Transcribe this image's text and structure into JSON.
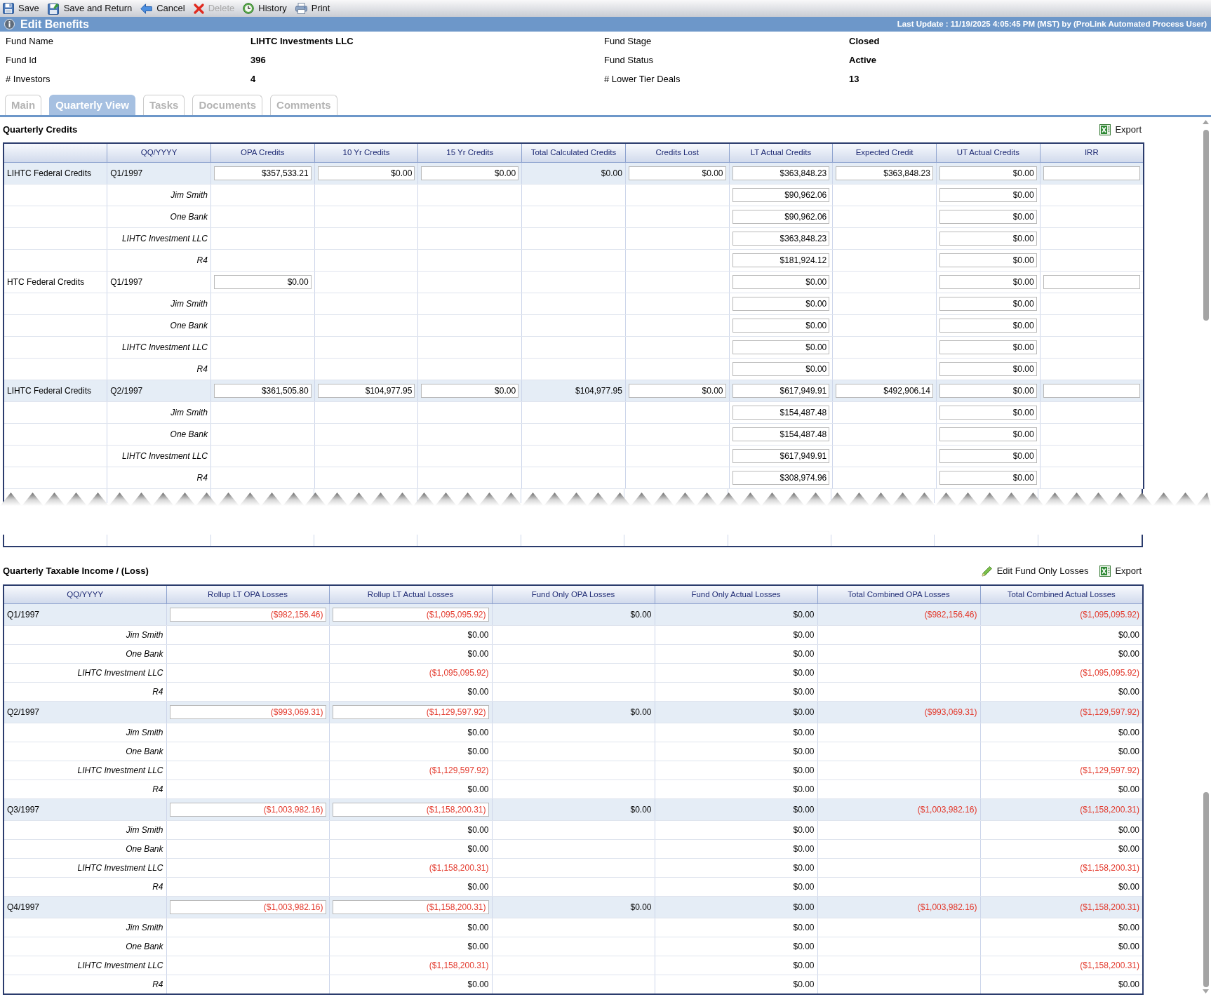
{
  "toolbar": [
    {
      "kind": "save",
      "label": "Save",
      "disabled": false
    },
    {
      "kind": "save_return",
      "label": "Save and Return",
      "disabled": false
    },
    {
      "kind": "cancel",
      "label": "Cancel",
      "disabled": false
    },
    {
      "kind": "delete",
      "label": "Delete",
      "disabled": true
    },
    {
      "kind": "history",
      "label": "History",
      "disabled": false
    },
    {
      "kind": "print",
      "label": "Print",
      "disabled": false
    }
  ],
  "header": {
    "title": "Edit Benefits",
    "last_update": "Last Update : 11/19/2025 4:05:45 PM (MST) by (ProLink Automated Process User)"
  },
  "fund_info": [
    {
      "label": "Fund Name",
      "value": "LIHTC Investments LLC"
    },
    {
      "label": "Fund Stage",
      "value": "Closed"
    },
    {
      "label": "Fund Id",
      "value": "396"
    },
    {
      "label": "Fund Status",
      "value": "Active"
    },
    {
      "label": "# Investors",
      "value": "4"
    },
    {
      "label": "# Lower Tier Deals",
      "value": "13"
    }
  ],
  "tabs": [
    {
      "label": "Main",
      "selected": false
    },
    {
      "label": "Quarterly View",
      "selected": true
    },
    {
      "label": "Tasks",
      "selected": false
    },
    {
      "label": "Documents",
      "selected": false
    },
    {
      "label": "Comments",
      "selected": false
    }
  ],
  "quarterly_credits": {
    "title": "Quarterly Credits",
    "actions": [
      {
        "kind": "export",
        "label": "Export"
      }
    ],
    "columns": [
      "",
      "QQ/YYYY",
      "OPA Credits",
      "10 Yr Credits",
      "15 Yr Credits",
      "Total Calculated Credits",
      "Credits Lost",
      "LT Actual Credits",
      "Expected Credit",
      "UT Actual Credits",
      "IRR"
    ],
    "rows": [
      {
        "shaded": true,
        "cells": [
          {
            "kind": "label",
            "value": "LIHTC Federal Credits"
          },
          {
            "kind": "label",
            "value": "Q1/1997"
          },
          {
            "kind": "input",
            "value": "$357,533.21"
          },
          {
            "kind": "input",
            "value": "$0.00"
          },
          {
            "kind": "input",
            "value": "$0.00"
          },
          {
            "kind": "text",
            "value": "$0.00"
          },
          {
            "kind": "input",
            "value": "$0.00"
          },
          {
            "kind": "input",
            "value": "$363,848.23"
          },
          {
            "kind": "input",
            "value": "$363,848.23"
          },
          {
            "kind": "input",
            "value": "$0.00"
          },
          {
            "kind": "input"
          }
        ]
      },
      {
        "shaded": false,
        "cells": [
          {
            "kind": "blank"
          },
          {
            "kind": "name",
            "value": "Jim Smith"
          },
          {
            "kind": "blank"
          },
          {
            "kind": "blank"
          },
          {
            "kind": "blank"
          },
          {
            "kind": "blank"
          },
          {
            "kind": "blank"
          },
          {
            "kind": "input",
            "value": "$90,962.06"
          },
          {
            "kind": "blank"
          },
          {
            "kind": "input",
            "value": "$0.00"
          },
          {
            "kind": "blank"
          }
        ]
      },
      {
        "shaded": false,
        "cells": [
          {
            "kind": "blank"
          },
          {
            "kind": "name",
            "value": "One Bank"
          },
          {
            "kind": "blank"
          },
          {
            "kind": "blank"
          },
          {
            "kind": "blank"
          },
          {
            "kind": "blank"
          },
          {
            "kind": "blank"
          },
          {
            "kind": "input",
            "value": "$90,962.06"
          },
          {
            "kind": "blank"
          },
          {
            "kind": "input",
            "value": "$0.00"
          },
          {
            "kind": "blank"
          }
        ]
      },
      {
        "shaded": false,
        "cells": [
          {
            "kind": "blank"
          },
          {
            "kind": "name",
            "value": "LIHTC Investment LLC"
          },
          {
            "kind": "blank"
          },
          {
            "kind": "blank"
          },
          {
            "kind": "blank"
          },
          {
            "kind": "blank"
          },
          {
            "kind": "blank"
          },
          {
            "kind": "input",
            "value": "$363,848.23"
          },
          {
            "kind": "blank"
          },
          {
            "kind": "input",
            "value": "$0.00"
          },
          {
            "kind": "blank"
          }
        ]
      },
      {
        "shaded": false,
        "cells": [
          {
            "kind": "blank"
          },
          {
            "kind": "name",
            "value": "R4"
          },
          {
            "kind": "blank"
          },
          {
            "kind": "blank"
          },
          {
            "kind": "blank"
          },
          {
            "kind": "blank"
          },
          {
            "kind": "blank"
          },
          {
            "kind": "input",
            "value": "$181,924.12"
          },
          {
            "kind": "blank"
          },
          {
            "kind": "input",
            "value": "$0.00"
          },
          {
            "kind": "blank"
          }
        ]
      },
      {
        "shaded": false,
        "cells": [
          {
            "kind": "label",
            "value": "HTC Federal Credits"
          },
          {
            "kind": "label",
            "value": "Q1/1997"
          },
          {
            "kind": "input",
            "value": "$0.00"
          },
          {
            "kind": "blank"
          },
          {
            "kind": "blank"
          },
          {
            "kind": "blank"
          },
          {
            "kind": "blank"
          },
          {
            "kind": "input",
            "value": "$0.00"
          },
          {
            "kind": "blank"
          },
          {
            "kind": "input",
            "value": "$0.00"
          },
          {
            "kind": "input"
          }
        ]
      },
      {
        "shaded": false,
        "cells": [
          {
            "kind": "blank"
          },
          {
            "kind": "name",
            "value": "Jim Smith"
          },
          {
            "kind": "blank"
          },
          {
            "kind": "blank"
          },
          {
            "kind": "blank"
          },
          {
            "kind": "blank"
          },
          {
            "kind": "blank"
          },
          {
            "kind": "input",
            "value": "$0.00"
          },
          {
            "kind": "blank"
          },
          {
            "kind": "input",
            "value": "$0.00"
          },
          {
            "kind": "blank"
          }
        ]
      },
      {
        "shaded": false,
        "cells": [
          {
            "kind": "blank"
          },
          {
            "kind": "name",
            "value": "One Bank"
          },
          {
            "kind": "blank"
          },
          {
            "kind": "blank"
          },
          {
            "kind": "blank"
          },
          {
            "kind": "blank"
          },
          {
            "kind": "blank"
          },
          {
            "kind": "input",
            "value": "$0.00"
          },
          {
            "kind": "blank"
          },
          {
            "kind": "input",
            "value": "$0.00"
          },
          {
            "kind": "blank"
          }
        ]
      },
      {
        "shaded": false,
        "cells": [
          {
            "kind": "blank"
          },
          {
            "kind": "name",
            "value": "LIHTC Investment LLC"
          },
          {
            "kind": "blank"
          },
          {
            "kind": "blank"
          },
          {
            "kind": "blank"
          },
          {
            "kind": "blank"
          },
          {
            "kind": "blank"
          },
          {
            "kind": "input",
            "value": "$0.00"
          },
          {
            "kind": "blank"
          },
          {
            "kind": "input",
            "value": "$0.00"
          },
          {
            "kind": "blank"
          }
        ]
      },
      {
        "shaded": false,
        "cells": [
          {
            "kind": "blank"
          },
          {
            "kind": "name",
            "value": "R4"
          },
          {
            "kind": "blank"
          },
          {
            "kind": "blank"
          },
          {
            "kind": "blank"
          },
          {
            "kind": "blank"
          },
          {
            "kind": "blank"
          },
          {
            "kind": "input",
            "value": "$0.00"
          },
          {
            "kind": "blank"
          },
          {
            "kind": "input",
            "value": "$0.00"
          },
          {
            "kind": "blank"
          }
        ]
      },
      {
        "shaded": true,
        "cells": [
          {
            "kind": "label",
            "value": "LIHTC Federal Credits"
          },
          {
            "kind": "label",
            "value": "Q2/1997"
          },
          {
            "kind": "input",
            "value": "$361,505.80"
          },
          {
            "kind": "input",
            "value": "$104,977.95"
          },
          {
            "kind": "input",
            "value": "$0.00"
          },
          {
            "kind": "text",
            "value": "$104,977.95"
          },
          {
            "kind": "input",
            "value": "$0.00"
          },
          {
            "kind": "input",
            "value": "$617,949.91"
          },
          {
            "kind": "input",
            "value": "$492,906.14"
          },
          {
            "kind": "input",
            "value": "$0.00"
          },
          {
            "kind": "input"
          }
        ]
      },
      {
        "shaded": false,
        "cells": [
          {
            "kind": "blank"
          },
          {
            "kind": "name",
            "value": "Jim Smith"
          },
          {
            "kind": "blank"
          },
          {
            "kind": "blank"
          },
          {
            "kind": "blank"
          },
          {
            "kind": "blank"
          },
          {
            "kind": "blank"
          },
          {
            "kind": "input",
            "value": "$154,487.48"
          },
          {
            "kind": "blank"
          },
          {
            "kind": "input",
            "value": "$0.00"
          },
          {
            "kind": "blank"
          }
        ]
      },
      {
        "shaded": false,
        "cells": [
          {
            "kind": "blank"
          },
          {
            "kind": "name",
            "value": "One Bank"
          },
          {
            "kind": "blank"
          },
          {
            "kind": "blank"
          },
          {
            "kind": "blank"
          },
          {
            "kind": "blank"
          },
          {
            "kind": "blank"
          },
          {
            "kind": "input",
            "value": "$154,487.48"
          },
          {
            "kind": "blank"
          },
          {
            "kind": "input",
            "value": "$0.00"
          },
          {
            "kind": "blank"
          }
        ]
      },
      {
        "shaded": false,
        "cells": [
          {
            "kind": "blank"
          },
          {
            "kind": "name",
            "value": "LIHTC Investment LLC"
          },
          {
            "kind": "blank"
          },
          {
            "kind": "blank"
          },
          {
            "kind": "blank"
          },
          {
            "kind": "blank"
          },
          {
            "kind": "blank"
          },
          {
            "kind": "input",
            "value": "$617,949.91"
          },
          {
            "kind": "blank"
          },
          {
            "kind": "input",
            "value": "$0.00"
          },
          {
            "kind": "blank"
          }
        ]
      },
      {
        "shaded": false,
        "cells": [
          {
            "kind": "blank"
          },
          {
            "kind": "name",
            "value": "R4"
          },
          {
            "kind": "blank"
          },
          {
            "kind": "blank"
          },
          {
            "kind": "blank"
          },
          {
            "kind": "blank"
          },
          {
            "kind": "blank"
          },
          {
            "kind": "input",
            "value": "$308,974.96"
          },
          {
            "kind": "blank"
          },
          {
            "kind": "input",
            "value": "$0.00"
          },
          {
            "kind": "blank"
          }
        ]
      }
    ]
  },
  "quarterly_taxable_income": {
    "title": "Quarterly Taxable Income / (Loss)",
    "actions": [
      {
        "kind": "edit",
        "label": "Edit Fund Only Losses"
      },
      {
        "kind": "export",
        "label": "Export"
      }
    ],
    "columns": [
      "QQ/YYYY",
      "Rollup LT OPA Losses",
      "Rollup LT Actual Losses",
      "Fund Only OPA Losses",
      "Fund Only Actual Losses",
      "Total Combined OPA Losses",
      "Total Combined Actual Losses"
    ],
    "rows": [
      {
        "kind": "quarter",
        "shaded": true,
        "cells": [
          {
            "kind": "label",
            "value": "Q1/1997"
          },
          {
            "kind": "input",
            "value": "($982,156.46)",
            "negative": true
          },
          {
            "kind": "input",
            "value": "($1,095,095.92)",
            "negative": true
          },
          {
            "kind": "text",
            "value": "$0.00",
            "negative": false
          },
          {
            "kind": "text",
            "value": "$0.00",
            "negative": false
          },
          {
            "kind": "text",
            "value": "($982,156.46)",
            "negative": true
          },
          {
            "kind": "text",
            "value": "($1,095,095.92)",
            "negative": true
          }
        ]
      },
      {
        "kind": "investor",
        "shaded": false,
        "cells": [
          {
            "kind": "name",
            "value": "Jim Smith"
          },
          {
            "kind": "blank"
          },
          {
            "kind": "text",
            "value": "$0.00",
            "negative": false
          },
          {
            "kind": "blank"
          },
          {
            "kind": "text",
            "value": "$0.00",
            "negative": false
          },
          {
            "kind": "blank"
          },
          {
            "kind": "text",
            "value": "$0.00",
            "negative": false
          }
        ]
      },
      {
        "kind": "investor",
        "shaded": false,
        "cells": [
          {
            "kind": "name",
            "value": "One Bank"
          },
          {
            "kind": "blank"
          },
          {
            "kind": "text",
            "value": "$0.00",
            "negative": false
          },
          {
            "kind": "blank"
          },
          {
            "kind": "text",
            "value": "$0.00",
            "negative": false
          },
          {
            "kind": "blank"
          },
          {
            "kind": "text",
            "value": "$0.00",
            "negative": false
          }
        ]
      },
      {
        "kind": "investor",
        "shaded": false,
        "cells": [
          {
            "kind": "name",
            "value": "LIHTC Investment LLC"
          },
          {
            "kind": "blank"
          },
          {
            "kind": "text",
            "value": "($1,095,095.92)",
            "negative": true
          },
          {
            "kind": "blank"
          },
          {
            "kind": "text",
            "value": "$0.00",
            "negative": false
          },
          {
            "kind": "blank"
          },
          {
            "kind": "text",
            "value": "($1,095,095.92)",
            "negative": true
          }
        ]
      },
      {
        "kind": "investor",
        "shaded": false,
        "cells": [
          {
            "kind": "name",
            "value": "R4"
          },
          {
            "kind": "blank"
          },
          {
            "kind": "text",
            "value": "$0.00",
            "negative": false
          },
          {
            "kind": "blank"
          },
          {
            "kind": "text",
            "value": "$0.00",
            "negative": false
          },
          {
            "kind": "blank"
          },
          {
            "kind": "text",
            "value": "$0.00",
            "negative": false
          }
        ]
      },
      {
        "kind": "quarter",
        "shaded": true,
        "cells": [
          {
            "kind": "label",
            "value": "Q2/1997"
          },
          {
            "kind": "input",
            "value": "($993,069.31)",
            "negative": true
          },
          {
            "kind": "input",
            "value": "($1,129,597.92)",
            "negative": true
          },
          {
            "kind": "text",
            "value": "$0.00",
            "negative": false
          },
          {
            "kind": "text",
            "value": "$0.00",
            "negative": false
          },
          {
            "kind": "text",
            "value": "($993,069.31)",
            "negative": true
          },
          {
            "kind": "text",
            "value": "($1,129,597.92)",
            "negative": true
          }
        ]
      },
      {
        "kind": "investor",
        "shaded": false,
        "cells": [
          {
            "kind": "name",
            "value": "Jim Smith"
          },
          {
            "kind": "blank"
          },
          {
            "kind": "text",
            "value": "$0.00",
            "negative": false
          },
          {
            "kind": "blank"
          },
          {
            "kind": "text",
            "value": "$0.00",
            "negative": false
          },
          {
            "kind": "blank"
          },
          {
            "kind": "text",
            "value": "$0.00",
            "negative": false
          }
        ]
      },
      {
        "kind": "investor",
        "shaded": false,
        "cells": [
          {
            "kind": "name",
            "value": "One Bank"
          },
          {
            "kind": "blank"
          },
          {
            "kind": "text",
            "value": "$0.00",
            "negative": false
          },
          {
            "kind": "blank"
          },
          {
            "kind": "text",
            "value": "$0.00",
            "negative": false
          },
          {
            "kind": "blank"
          },
          {
            "kind": "text",
            "value": "$0.00",
            "negative": false
          }
        ]
      },
      {
        "kind": "investor",
        "shaded": false,
        "cells": [
          {
            "kind": "name",
            "value": "LIHTC Investment LLC"
          },
          {
            "kind": "blank"
          },
          {
            "kind": "text",
            "value": "($1,129,597.92)",
            "negative": true
          },
          {
            "kind": "blank"
          },
          {
            "kind": "text",
            "value": "$0.00",
            "negative": false
          },
          {
            "kind": "blank"
          },
          {
            "kind": "text",
            "value": "($1,129,597.92)",
            "negative": true
          }
        ]
      },
      {
        "kind": "investor",
        "shaded": false,
        "cells": [
          {
            "kind": "name",
            "value": "R4"
          },
          {
            "kind": "blank"
          },
          {
            "kind": "text",
            "value": "$0.00",
            "negative": false
          },
          {
            "kind": "blank"
          },
          {
            "kind": "text",
            "value": "$0.00",
            "negative": false
          },
          {
            "kind": "blank"
          },
          {
            "kind": "text",
            "value": "$0.00",
            "negative": false
          }
        ]
      },
      {
        "kind": "quarter",
        "shaded": true,
        "cells": [
          {
            "kind": "label",
            "value": "Q3/1997"
          },
          {
            "kind": "input",
            "value": "($1,003,982.16)",
            "negative": true
          },
          {
            "kind": "input",
            "value": "($1,158,200.31)",
            "negative": true
          },
          {
            "kind": "text",
            "value": "$0.00",
            "negative": false
          },
          {
            "kind": "text",
            "value": "$0.00",
            "negative": false
          },
          {
            "kind": "text",
            "value": "($1,003,982.16)",
            "negative": true
          },
          {
            "kind": "text",
            "value": "($1,158,200.31)",
            "negative": true
          }
        ]
      },
      {
        "kind": "investor",
        "shaded": false,
        "cells": [
          {
            "kind": "name",
            "value": "Jim Smith"
          },
          {
            "kind": "blank"
          },
          {
            "kind": "text",
            "value": "$0.00",
            "negative": false
          },
          {
            "kind": "blank"
          },
          {
            "kind": "text",
            "value": "$0.00",
            "negative": false
          },
          {
            "kind": "blank"
          },
          {
            "kind": "text",
            "value": "$0.00",
            "negative": false
          }
        ]
      },
      {
        "kind": "investor",
        "shaded": false,
        "cells": [
          {
            "kind": "name",
            "value": "One Bank"
          },
          {
            "kind": "blank"
          },
          {
            "kind": "text",
            "value": "$0.00",
            "negative": false
          },
          {
            "kind": "blank"
          },
          {
            "kind": "text",
            "value": "$0.00",
            "negative": false
          },
          {
            "kind": "blank"
          },
          {
            "kind": "text",
            "value": "$0.00",
            "negative": false
          }
        ]
      },
      {
        "kind": "investor",
        "shaded": false,
        "cells": [
          {
            "kind": "name",
            "value": "LIHTC Investment LLC"
          },
          {
            "kind": "blank"
          },
          {
            "kind": "text",
            "value": "($1,158,200.31)",
            "negative": true
          },
          {
            "kind": "blank"
          },
          {
            "kind": "text",
            "value": "$0.00",
            "negative": false
          },
          {
            "kind": "blank"
          },
          {
            "kind": "text",
            "value": "($1,158,200.31)",
            "negative": true
          }
        ]
      },
      {
        "kind": "investor",
        "shaded": false,
        "cells": [
          {
            "kind": "name",
            "value": "R4"
          },
          {
            "kind": "blank"
          },
          {
            "kind": "text",
            "value": "$0.00",
            "negative": false
          },
          {
            "kind": "blank"
          },
          {
            "kind": "text",
            "value": "$0.00",
            "negative": false
          },
          {
            "kind": "blank"
          },
          {
            "kind": "text",
            "value": "$0.00",
            "negative": false
          }
        ]
      },
      {
        "kind": "quarter",
        "shaded": true,
        "cells": [
          {
            "kind": "label",
            "value": "Q4/1997"
          },
          {
            "kind": "input",
            "value": "($1,003,982.16)",
            "negative": true
          },
          {
            "kind": "input",
            "value": "($1,158,200.31)",
            "negative": true
          },
          {
            "kind": "text",
            "value": "$0.00",
            "negative": false
          },
          {
            "kind": "text",
            "value": "$0.00",
            "negative": false
          },
          {
            "kind": "text",
            "value": "($1,003,982.16)",
            "negative": true
          },
          {
            "kind": "text",
            "value": "($1,158,200.31)",
            "negative": true
          }
        ]
      },
      {
        "kind": "investor",
        "shaded": false,
        "cells": [
          {
            "kind": "name",
            "value": "Jim Smith"
          },
          {
            "kind": "blank"
          },
          {
            "kind": "text",
            "value": "$0.00",
            "negative": false
          },
          {
            "kind": "blank"
          },
          {
            "kind": "text",
            "value": "$0.00",
            "negative": false
          },
          {
            "kind": "blank"
          },
          {
            "kind": "text",
            "value": "$0.00",
            "negative": false
          }
        ]
      },
      {
        "kind": "investor",
        "shaded": false,
        "cells": [
          {
            "kind": "name",
            "value": "One Bank"
          },
          {
            "kind": "blank"
          },
          {
            "kind": "text",
            "value": "$0.00",
            "negative": false
          },
          {
            "kind": "blank"
          },
          {
            "kind": "text",
            "value": "$0.00",
            "negative": false
          },
          {
            "kind": "blank"
          },
          {
            "kind": "text",
            "value": "$0.00",
            "negative": false
          }
        ]
      },
      {
        "kind": "investor",
        "shaded": false,
        "cells": [
          {
            "kind": "name",
            "value": "LIHTC Investment LLC"
          },
          {
            "kind": "blank"
          },
          {
            "kind": "text",
            "value": "($1,158,200.31)",
            "negative": true
          },
          {
            "kind": "blank"
          },
          {
            "kind": "text",
            "value": "$0.00",
            "negative": false
          },
          {
            "kind": "blank"
          },
          {
            "kind": "text",
            "value": "($1,158,200.31)",
            "negative": true
          }
        ]
      },
      {
        "kind": "investor",
        "shaded": false,
        "cells": [
          {
            "kind": "name",
            "value": "R4"
          },
          {
            "kind": "blank"
          },
          {
            "kind": "text",
            "value": "$0.00",
            "negative": false
          },
          {
            "kind": "blank"
          },
          {
            "kind": "text",
            "value": "$0.00",
            "negative": false
          },
          {
            "kind": "blank"
          },
          {
            "kind": "text",
            "value": "$0.00",
            "negative": false
          }
        ]
      }
    ]
  }
}
